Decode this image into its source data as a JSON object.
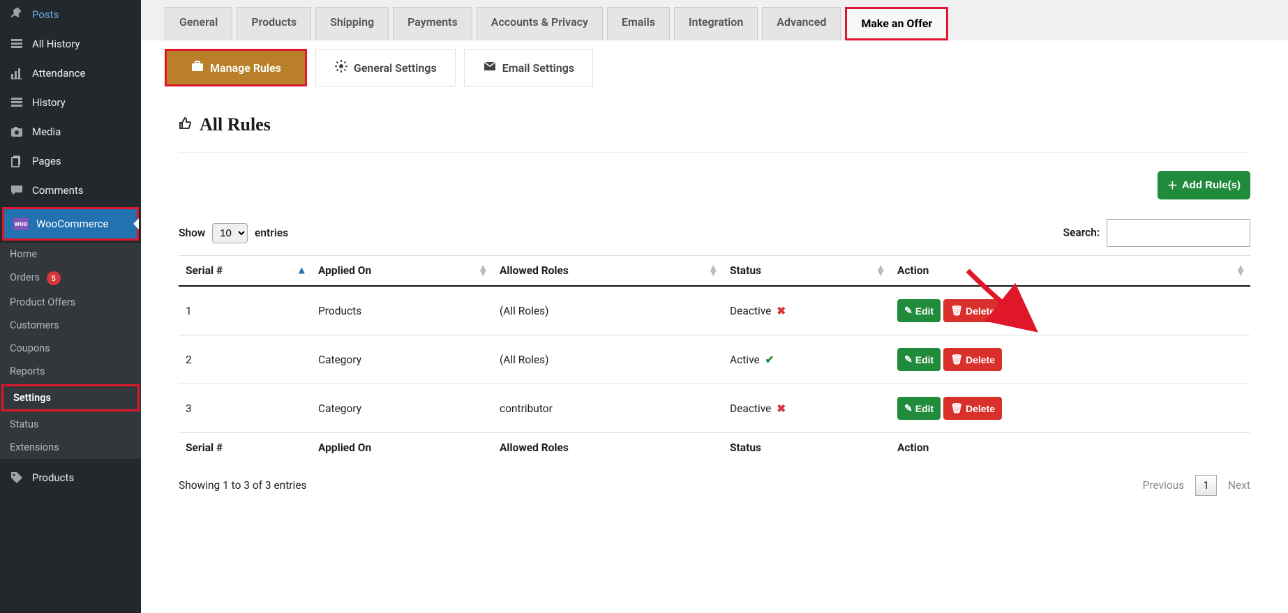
{
  "sidebar": {
    "items": [
      {
        "label": "Posts",
        "icon": "pin"
      },
      {
        "label": "All History",
        "icon": "grid"
      },
      {
        "label": "Attendance",
        "icon": "chart"
      },
      {
        "label": "History",
        "icon": "grid"
      },
      {
        "label": "Media",
        "icon": "camera"
      },
      {
        "label": "Pages",
        "icon": "stack"
      },
      {
        "label": "Comments",
        "icon": "comment"
      }
    ],
    "wc_label": "WooCommerce",
    "wc_sub": [
      {
        "label": "Home"
      },
      {
        "label": "Orders",
        "badge": "5"
      },
      {
        "label": "Product Offers"
      },
      {
        "label": "Customers"
      },
      {
        "label": "Coupons"
      },
      {
        "label": "Reports"
      },
      {
        "label": "Settings"
      },
      {
        "label": "Status"
      },
      {
        "label": "Extensions"
      }
    ],
    "products_label": "Products"
  },
  "tabs": [
    "General",
    "Products",
    "Shipping",
    "Payments",
    "Accounts & Privacy",
    "Emails",
    "Integration",
    "Advanced",
    "Make an Offer"
  ],
  "subtabs": {
    "manage": "Manage Rules",
    "general": "General Settings",
    "email": "Email Settings"
  },
  "panel_title": "All Rules",
  "add_rules": "Add Rule(s)",
  "show_label": "Show",
  "entries_label": "entries",
  "length_value": "10",
  "search_label": "Search:",
  "columns": [
    "Serial #",
    "Applied On",
    "Allowed Roles",
    "Status",
    "Action"
  ],
  "rows": [
    {
      "serial": "1",
      "applied": "Products",
      "roles": "(All Roles)",
      "status": "Deactive",
      "active": false,
      "edit": "Edit",
      "delete": "Delete"
    },
    {
      "serial": "2",
      "applied": "Category",
      "roles": "(All Roles)",
      "status": "Active",
      "active": true,
      "edit": "Edit",
      "delete": "Delete"
    },
    {
      "serial": "3",
      "applied": "Category",
      "roles": "contributor",
      "status": "Deactive",
      "active": false,
      "edit": "Edit",
      "delete": "Delete"
    }
  ],
  "info": "Showing 1 to 3 of 3 entries",
  "pager": {
    "prev": "Previous",
    "num": "1",
    "next": "Next"
  }
}
